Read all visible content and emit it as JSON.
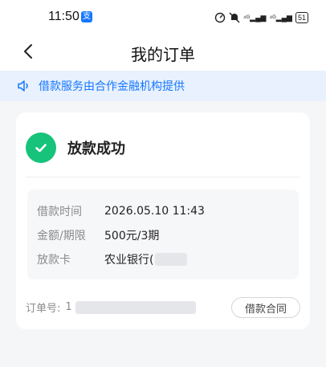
{
  "status_bar": {
    "time": "11:50",
    "app_badge": "支",
    "network_1": "⁴ᴳ",
    "network_2": "⁴ᴳ",
    "battery": "51"
  },
  "nav": {
    "title": "我的订单",
    "back_icon": "chevron-left-icon"
  },
  "notice": {
    "icon": "speaker-icon",
    "text": "借款服务由合作金融机构提供",
    "color": "#1677ff"
  },
  "status": {
    "icon": "check-circle-icon",
    "text": "放款成功",
    "color": "#17c37a"
  },
  "details": [
    {
      "label": "借款时间",
      "value": "2026.05.10 11:43"
    },
    {
      "label": "金额/期限",
      "value": "500元/3期"
    },
    {
      "label": "放款卡",
      "value": "农业银行("
    }
  ],
  "order": {
    "label": "订单号:",
    "value_visible": "1"
  },
  "contract_button": "借款合同"
}
